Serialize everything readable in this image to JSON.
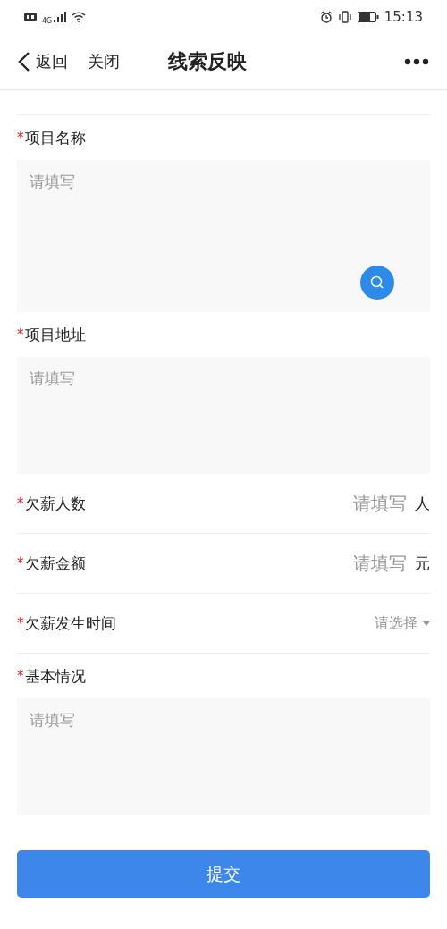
{
  "status_bar": {
    "network": "4G",
    "time": "15:13"
  },
  "header": {
    "back": "返回",
    "close": "关闭",
    "title": "线索反映"
  },
  "fields": [
    {
      "kind": "search_textarea",
      "required_mark": "*",
      "label": "项目名称",
      "placeholder": "请填写"
    },
    {
      "kind": "textarea",
      "required_mark": "*",
      "label": "项目地址",
      "placeholder": "请填写"
    },
    {
      "kind": "input",
      "required_mark": "*",
      "label": "欠薪人数",
      "placeholder": "请填写",
      "unit": "人"
    },
    {
      "kind": "input",
      "required_mark": "*",
      "label": "欠薪金额",
      "placeholder": "请填写",
      "unit": "元"
    },
    {
      "kind": "select",
      "required_mark": "*",
      "label": "欠薪发生时间",
      "placeholder": "请选择"
    },
    {
      "kind": "textarea",
      "required_mark": "*",
      "label": "基本情况",
      "placeholder": "请填写"
    }
  ],
  "submit": "提交"
}
